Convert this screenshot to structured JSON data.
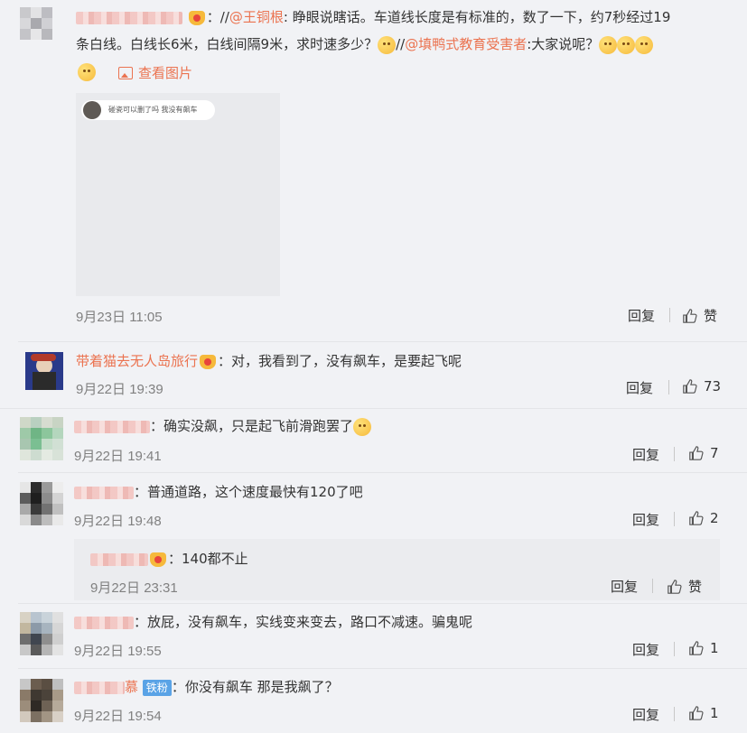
{
  "comments": [
    {
      "text_part1": "：//",
      "mention1": "@王铜根",
      "text_part2": ": 睁眼说瞎话。车道线长度是有标准的，数了一下，约7秒经过19",
      "text_line2a": "条白线。白线长6米，白线间隔9米，求时速多少？",
      "text_line2b": "//",
      "mention2": "@填鸭式教育受害者",
      "text_line2c": ":大家说呢？",
      "view_image": "查看图片",
      "image_text": "碰瓷可以删了吗   我没有飙车",
      "time": "9月23日 11:05",
      "reply": "回复",
      "like": "赞"
    },
    {
      "name": "带着猫去无人岛旅行",
      "text": "：对，我看到了，没有飙车，是要起飞呢",
      "time": "9月22日 19:39",
      "reply": "回复",
      "like": "73"
    },
    {
      "text": "：确实没飙，只是起飞前滑跑罢了",
      "time": "9月22日 19:41",
      "reply": "回复",
      "like": "7"
    },
    {
      "text": "：普通道路，这个速度最快有120了吧",
      "time": "9月22日 19:48",
      "reply": "回复",
      "like": "2"
    },
    {
      "text": "：140都不止",
      "time": "9月22日 23:31",
      "reply": "回复",
      "like": "赞"
    },
    {
      "text": "：放屁，没有飙车，实线变来变去，路口不减速。骗鬼呢",
      "time": "9月22日 19:55",
      "reply": "回复",
      "like": "1"
    },
    {
      "name_suffix": "慕",
      "badge": "铁粉",
      "text": "：你没有飙车 那是我飙了？",
      "time": "9月22日 19:54",
      "reply": "回复",
      "like": "1"
    }
  ],
  "colors": {
    "accent": "#eb7350",
    "badge": "#5aa3e6",
    "background": "#f1f2f5"
  },
  "icons": [
    "like-icon",
    "image-icon",
    "vip-badge-icon",
    "emoji-icon"
  ]
}
